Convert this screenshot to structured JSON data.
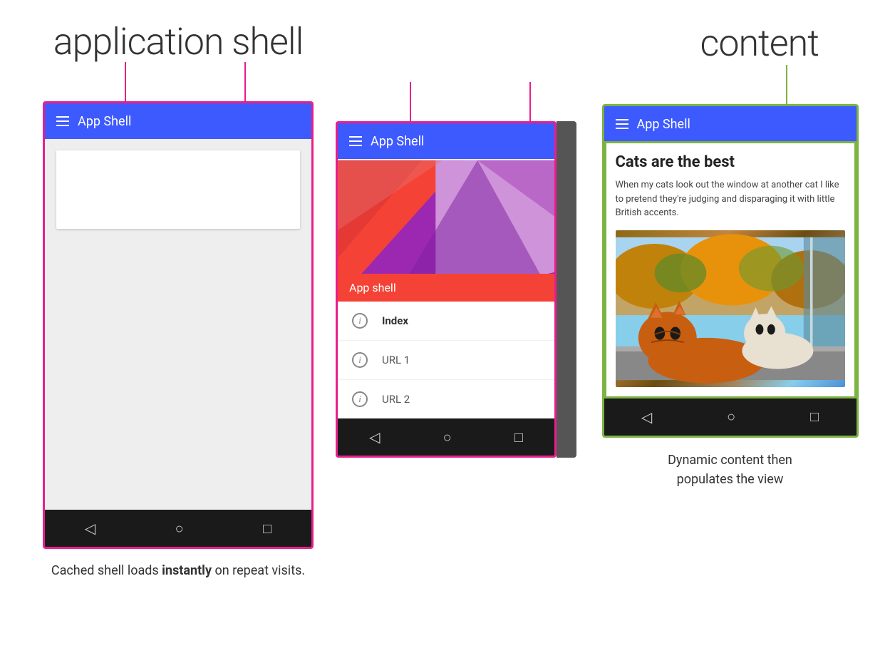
{
  "left": {
    "section_label": "application shell",
    "connector_lines": true,
    "phone1": {
      "header_title": "App Shell",
      "nav_back": "◁",
      "nav_home": "○",
      "nav_recent": "□"
    },
    "caption": "Cached shell loads ",
    "caption_bold": "instantly",
    "caption_rest": " on repeat visits."
  },
  "middle": {
    "phone2": {
      "header_title": "App Shell",
      "app_shell_label": "App shell",
      "menu_items": [
        {
          "icon": "i",
          "label": "Index",
          "bold": true
        },
        {
          "icon": "i",
          "label": "URL 1",
          "bold": false
        },
        {
          "icon": "i",
          "label": "URL 2",
          "bold": false
        }
      ],
      "nav_back": "◁",
      "nav_home": "○",
      "nav_recent": "□"
    }
  },
  "right": {
    "section_label": "content",
    "phone3": {
      "header_title": "App Shell",
      "content_title": "Cats are the best",
      "content_desc": "When my cats look out the window at another cat I like to pretend they're judging and disparaging it with little British accents.",
      "nav_back": "◁",
      "nav_home": "○",
      "nav_recent": "□"
    },
    "caption_line1": "Dynamic content then",
    "caption_line2": "populates the view"
  },
  "colors": {
    "pink": "#e91e8c",
    "green": "#7cb342",
    "blue": "#3d5afe",
    "dark_nav": "#1a1a1a"
  }
}
